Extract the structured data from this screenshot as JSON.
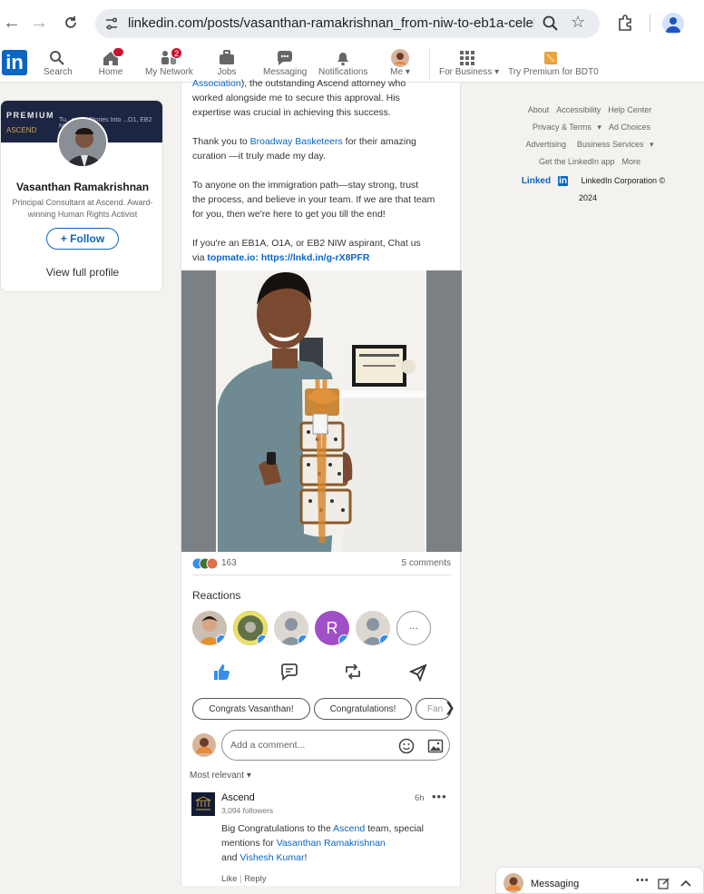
{
  "browser": {
    "url": "linkedin.com/posts/vasanthan-ramakrishnan_from-niw-to-eb1a-celebr..."
  },
  "nav": {
    "items": [
      {
        "label": "Search"
      },
      {
        "label": "Home",
        "badge": ""
      },
      {
        "label": "My Network",
        "badge": "2"
      },
      {
        "label": "Jobs"
      },
      {
        "label": "Messaging"
      },
      {
        "label": "Notifications"
      },
      {
        "label": "Me"
      },
      {
        "label": "For Business"
      },
      {
        "label": "Try Premium for BDT0"
      }
    ]
  },
  "profile": {
    "premium": "PREMIUM",
    "name": "Vasanthan Ramakrishnan",
    "tagline": "Principal Consultant at Ascend. Award-winning Human Rights Activist",
    "follow": "+ Follow",
    "view": "View full profile",
    "banner_text": "Tu...ecent Stories Into ...O1, EB2 NIW & O1",
    "banner_logo": "ASCEND"
  },
  "post": {
    "line1_link": "Association",
    "line1_rest": "), the outstanding Ascend attorney who",
    "line2": "worked alongside me to secure this approval. His",
    "line3": "expertise was crucial in achieving this success.",
    "thanks_a": "Thank you to ",
    "thanks_link": "Broadway Basketeers",
    "thanks_b": " for their amazing",
    "thanks_c": "curation —it truly made my day.",
    "imm1": "To anyone on the immigration path—stay strong, trust",
    "imm2": "the process, and believe in your team. If we are that team",
    "imm3": "for you, then we're here to get you till the end!",
    "cta1": "If you're an EB1A, O1A, or EB2 NIW aspirant, Chat us",
    "cta2_a": "via ",
    "cta2_link": "topmate.io: https://lnkd.in/g-rX8PFR"
  },
  "stats": {
    "reactions": "163",
    "comments": "5 comments"
  },
  "reactions_title": "Reactions",
  "reaction_letter": "R",
  "more_reactions": "...",
  "chips": [
    "Congrats Vasanthan!",
    "Congratulations!",
    "Fan"
  ],
  "comment_placeholder": "Add a comment...",
  "sort": "Most relevant",
  "comment": {
    "author": "Ascend",
    "followers": "3,094 followers",
    "time": "6h",
    "text_a": "Big Congratulations to the ",
    "text_link1": "Ascend",
    "text_b": " team, special",
    "text_c": "mentions for ",
    "text_link2": "Vasanthan Ramakrishnan",
    "text_d": " and ",
    "text_link3": "Vishesh Kumar",
    "text_e": "!",
    "like": "Like",
    "reply": "Reply"
  },
  "footer": {
    "links_row1": [
      "About",
      "Accessibility",
      "Help Center"
    ],
    "links_row2": [
      "Privacy & Terms",
      "Ad Choices"
    ],
    "links_row3": [
      "Advertising",
      "Business Services"
    ],
    "links_row4": [
      "Get the LinkedIn app",
      "More"
    ],
    "brand": "Linked",
    "brand_in": "in",
    "copyright": "LinkedIn Corporation © 2024"
  },
  "messaging": {
    "label": "Messaging"
  },
  "colors": {
    "accent": "#0a66c2",
    "badge": "#cb112d",
    "background": "#f4f2ee"
  }
}
